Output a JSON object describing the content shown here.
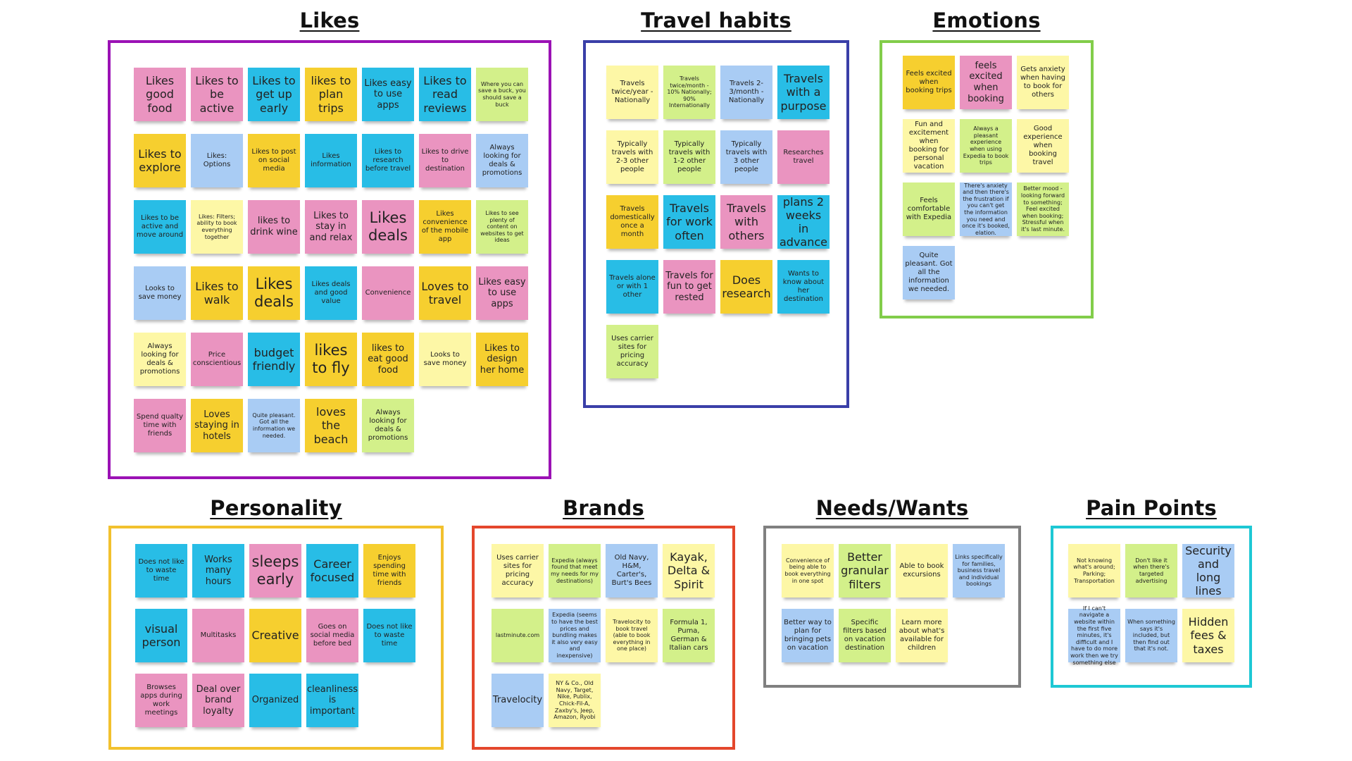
{
  "board": {
    "groups": [
      {
        "id": "likes",
        "title": "Likes",
        "frame_color": "#9b12b5",
        "notes": [
          {
            "text": "Likes good food",
            "color": "pink",
            "size": "l"
          },
          {
            "text": "Likes to be active",
            "color": "pink",
            "size": "l"
          },
          {
            "text": "Likes to get up early",
            "color": "blue",
            "size": "l"
          },
          {
            "text": "likes to plan trips",
            "color": "yellow",
            "size": "l"
          },
          {
            "text": "Likes easy to use apps",
            "color": "blue",
            "size": "m"
          },
          {
            "text": "Likes to read reviews",
            "color": "blue",
            "size": "l"
          },
          {
            "text": "Where you can save a buck, you should save a buck",
            "color": "green",
            "size": "xs"
          },
          {
            "text": "Likes to explore",
            "color": "yellow",
            "size": "l"
          },
          {
            "text": "Likes: Options",
            "color": "lblue",
            "size": "s"
          },
          {
            "text": "Likes to post on social media",
            "color": "yellow",
            "size": "s"
          },
          {
            "text": "Likes information",
            "color": "blue",
            "size": "s"
          },
          {
            "text": "Likes to research before travel",
            "color": "blue",
            "size": "s"
          },
          {
            "text": "Likes to drive to destination",
            "color": "pink",
            "size": "s"
          },
          {
            "text": "Always looking for deals & promotions",
            "color": "lblue",
            "size": "s"
          },
          {
            "text": "Likes to be active and move around",
            "color": "blue",
            "size": "s"
          },
          {
            "text": "Likes: Filters; ability to book everything together",
            "color": "lyellow",
            "size": "xs"
          },
          {
            "text": "likes to drink wine",
            "color": "pink",
            "size": "m"
          },
          {
            "text": "Likes to stay in and relax",
            "color": "pink",
            "size": "m"
          },
          {
            "text": "Likes deals",
            "color": "pink",
            "size": "xl"
          },
          {
            "text": "Likes convenience of the mobile app",
            "color": "yellow",
            "size": "s"
          },
          {
            "text": "Likes to see plenty of content on websites to get ideas",
            "color": "green",
            "size": "xs"
          },
          {
            "text": "Looks to save money",
            "color": "lblue",
            "size": "s"
          },
          {
            "text": "Likes to walk",
            "color": "yellow",
            "size": "l"
          },
          {
            "text": "Likes deals",
            "color": "yellow",
            "size": "xl"
          },
          {
            "text": "Likes deals and good value",
            "color": "blue",
            "size": "s"
          },
          {
            "text": "Convenience",
            "color": "pink",
            "size": "s"
          },
          {
            "text": "Loves to travel",
            "color": "yellow",
            "size": "l"
          },
          {
            "text": "Likes easy to use apps",
            "color": "pink",
            "size": "m"
          },
          {
            "text": "Always looking for deals & promotions",
            "color": "lyellow",
            "size": "s"
          },
          {
            "text": "Price conscientious",
            "color": "pink",
            "size": "s"
          },
          {
            "text": "budget friendly",
            "color": "blue",
            "size": "l"
          },
          {
            "text": "likes to fly",
            "color": "yellow",
            "size": "xl"
          },
          {
            "text": "likes to eat good food",
            "color": "yellow",
            "size": "m"
          },
          {
            "text": "Looks to save money",
            "color": "lyellow",
            "size": "s"
          },
          {
            "text": "Likes to design her home",
            "color": "yellow",
            "size": "m"
          },
          {
            "text": "Spend qualty time with friends",
            "color": "pink",
            "size": "s"
          },
          {
            "text": "Loves staying in hotels",
            "color": "yellow",
            "size": "m"
          },
          {
            "text": "Quite pleasant. Got all the information we needed.",
            "color": "lblue",
            "size": "xs"
          },
          {
            "text": "loves the beach",
            "color": "yellow",
            "size": "l"
          },
          {
            "text": "Always looking for deals & promotions",
            "color": "green",
            "size": "s"
          }
        ]
      },
      {
        "id": "travel-habits",
        "title": "Travel habits",
        "frame_color": "#3a3fa8",
        "notes": [
          {
            "text": "Travels twice/year - Nationally",
            "color": "lyellow",
            "size": "s"
          },
          {
            "text": "Travels twice/month - 10% Nationally; 90% Internationally",
            "color": "green",
            "size": "xs"
          },
          {
            "text": "Travels 2-3/month - Nationally",
            "color": "lblue",
            "size": "s"
          },
          {
            "text": "Travels with a purpose",
            "color": "blue",
            "size": "l"
          },
          {
            "text": "Typically travels with 2-3 other people",
            "color": "lyellow",
            "size": "s"
          },
          {
            "text": "Typically travels with 1-2 other people",
            "color": "green",
            "size": "s"
          },
          {
            "text": "Typically travels with 3 other people",
            "color": "lblue",
            "size": "s"
          },
          {
            "text": "Researches travel",
            "color": "pink",
            "size": "s"
          },
          {
            "text": "Travels domestically once a month",
            "color": "yellow",
            "size": "s"
          },
          {
            "text": "Travels for work often",
            "color": "blue",
            "size": "l"
          },
          {
            "text": "Travels with others",
            "color": "pink",
            "size": "l"
          },
          {
            "text": "plans 2 weeks in advance",
            "color": "blue",
            "size": "l"
          },
          {
            "text": "Travels alone or with 1 other",
            "color": "blue",
            "size": "s"
          },
          {
            "text": "Travels for fun to get rested",
            "color": "pink",
            "size": "m"
          },
          {
            "text": "Does research",
            "color": "yellow",
            "size": "l"
          },
          {
            "text": "Wants to know about her destination",
            "color": "blue",
            "size": "s"
          },
          {
            "text": "Uses carrier sites for pricing accuracy",
            "color": "green",
            "size": "s"
          }
        ]
      },
      {
        "id": "emotions",
        "title": "Emotions",
        "frame_color": "#82cd4a",
        "notes": [
          {
            "text": "Feels excited when booking trips",
            "color": "yellow",
            "size": "s"
          },
          {
            "text": "feels excited when booking",
            "color": "pink",
            "size": "m"
          },
          {
            "text": "Gets anxiety when having to book for others",
            "color": "lyellow",
            "size": "s"
          },
          {
            "text": "Fun and excitement when booking for personal vacation",
            "color": "lyellow",
            "size": "s"
          },
          {
            "text": "Always a pleasant experience when using Expedia to book trips",
            "color": "green",
            "size": "xs"
          },
          {
            "text": "Good experience when booking travel",
            "color": "lyellow",
            "size": "s"
          },
          {
            "text": "Feels comfortable with Expedia",
            "color": "green",
            "size": "s"
          },
          {
            "text": "There's anxiety and then there's the frustration if you can't get the information you need and once it's booked, elation.",
            "color": "lblue",
            "size": "xs"
          },
          {
            "text": "Better mood - looking forward to something; Feel excited when booking; Stressful when it's last minute.",
            "color": "green",
            "size": "xs"
          },
          {
            "text": "Quite pleasant. Got all the information we needed.",
            "color": "lblue",
            "size": "s"
          }
        ]
      },
      {
        "id": "personality",
        "title": "Personality",
        "frame_color": "#f2c12e",
        "notes": [
          {
            "text": "Does not like to waste time",
            "color": "blue",
            "size": "s"
          },
          {
            "text": "Works many hours",
            "color": "blue",
            "size": "m"
          },
          {
            "text": "sleeps early",
            "color": "pink",
            "size": "xl"
          },
          {
            "text": "Career focused",
            "color": "blue",
            "size": "l"
          },
          {
            "text": "Enjoys spending time with friends",
            "color": "yellow",
            "size": "s"
          },
          {
            "text": "visual person",
            "color": "blue",
            "size": "l"
          },
          {
            "text": "Multitasks",
            "color": "pink",
            "size": "s"
          },
          {
            "text": "Creative",
            "color": "yellow",
            "size": "l"
          },
          {
            "text": "Goes on social media before bed",
            "color": "pink",
            "size": "s"
          },
          {
            "text": "Does not like to waste time",
            "color": "blue",
            "size": "s"
          },
          {
            "text": "Browses apps during work meetings",
            "color": "pink",
            "size": "s"
          },
          {
            "text": "Deal over brand loyalty",
            "color": "pink",
            "size": "m"
          },
          {
            "text": "Organized",
            "color": "blue",
            "size": "m"
          },
          {
            "text": "cleanliness is important",
            "color": "blue",
            "size": "m"
          }
        ]
      },
      {
        "id": "brands",
        "title": "Brands",
        "frame_color": "#e4472c",
        "notes": [
          {
            "text": "Uses carrier sites for pricing accuracy",
            "color": "lyellow",
            "size": "s"
          },
          {
            "text": "Expedia (always found that meet my needs for my destinations)",
            "color": "green",
            "size": "xs"
          },
          {
            "text": "Old Navy, H&M, Carter's, Burt's Bees",
            "color": "lblue",
            "size": "s"
          },
          {
            "text": "Kayak, Delta & Spirit",
            "color": "lyellow",
            "size": "l"
          },
          {
            "text": "lastminute.com",
            "color": "green",
            "size": "xs"
          },
          {
            "text": "Expedia (seems to have the best prices and bundling makes it also very easy and inexpensive)",
            "color": "lblue",
            "size": "xs"
          },
          {
            "text": "Travelocity to book travel (able to book everything in one place)",
            "color": "lyellow",
            "size": "xs"
          },
          {
            "text": "Formula 1, Puma, German & Italian cars",
            "color": "green",
            "size": "s"
          },
          {
            "text": "Travelocity",
            "color": "lblue",
            "size": "m"
          },
          {
            "text": "NY & Co., Old Navy, Target, Nike, Publix, Chick-Fil-A, Zaxby's, Jeep, Amazon, Ryobi",
            "color": "lyellow",
            "size": "xs"
          }
        ]
      },
      {
        "id": "needs-wants",
        "title": "Needs/Wants",
        "frame_color": "#808080",
        "notes": [
          {
            "text": "Convenience of being able to book everything in one spot",
            "color": "lyellow",
            "size": "xs"
          },
          {
            "text": "Better granular filters",
            "color": "green",
            "size": "l"
          },
          {
            "text": "Able to book excursions",
            "color": "lyellow",
            "size": "s"
          },
          {
            "text": "Links specifically for families, business travel and individual bookings",
            "color": "lblue",
            "size": "xs"
          },
          {
            "text": "Better way to plan for bringing pets on vacation",
            "color": "lblue",
            "size": "s"
          },
          {
            "text": "Specific filters based on vacation destination",
            "color": "green",
            "size": "s"
          },
          {
            "text": "Learn more about what's available for children",
            "color": "lyellow",
            "size": "s"
          }
        ]
      },
      {
        "id": "pain-points",
        "title": "Pain Points",
        "frame_color": "#1ec8d4",
        "notes": [
          {
            "text": "Not knowing what's around; Parking; Transportation",
            "color": "lyellow",
            "size": "xs"
          },
          {
            "text": "Don't like it when there's targeted advertising",
            "color": "green",
            "size": "xs"
          },
          {
            "text": "Security and long lines",
            "color": "lblue",
            "size": "l"
          },
          {
            "text": "If I can't navigate a website within the first five minutes, it's difficult and I have to do more work then we try something else",
            "color": "lblue",
            "size": "xs"
          },
          {
            "text": "When something says it's included, but then find out that it's not.",
            "color": "lblue",
            "size": "xs"
          },
          {
            "text": "Hidden fees & taxes",
            "color": "lyellow",
            "size": "l"
          }
        ]
      }
    ]
  }
}
